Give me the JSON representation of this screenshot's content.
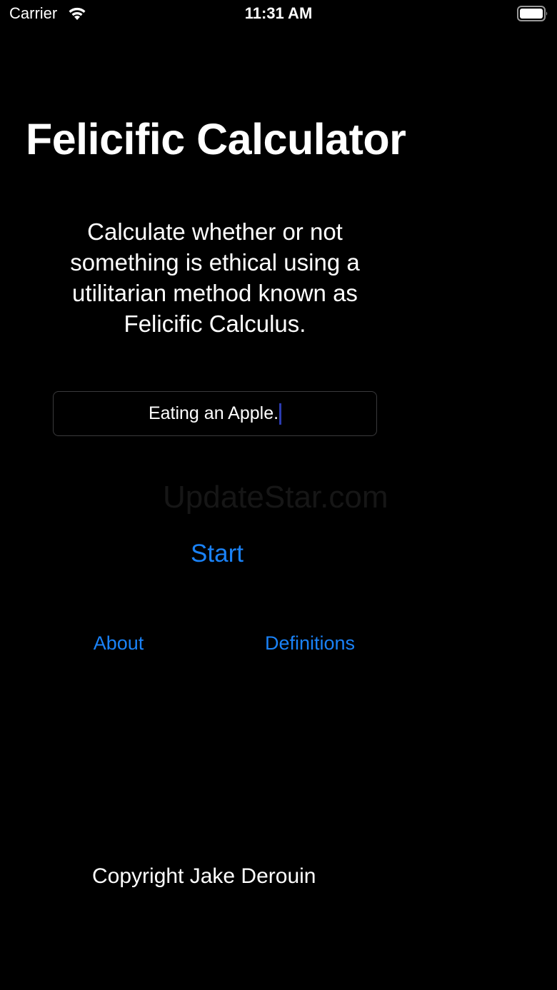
{
  "status_bar": {
    "carrier": "Carrier",
    "time": "11:31 AM",
    "wifi_icon": "wifi-icon",
    "battery_icon": "battery-full-icon"
  },
  "app": {
    "title": "Felicific Calculator",
    "description": "Calculate whether or not something is ethical using a utilitarian method known as Felicific Calculus.",
    "input_value": "Eating an Apple.",
    "watermark": "UpdateStar.com",
    "start_label": "Start",
    "about_label": "About",
    "definitions_label": "Definitions",
    "copyright": "Copyright Jake Derouin"
  },
  "colors": {
    "background": "#000000",
    "text": "#ffffff",
    "accent": "#1a82f7",
    "caret": "#2b3bb0"
  }
}
